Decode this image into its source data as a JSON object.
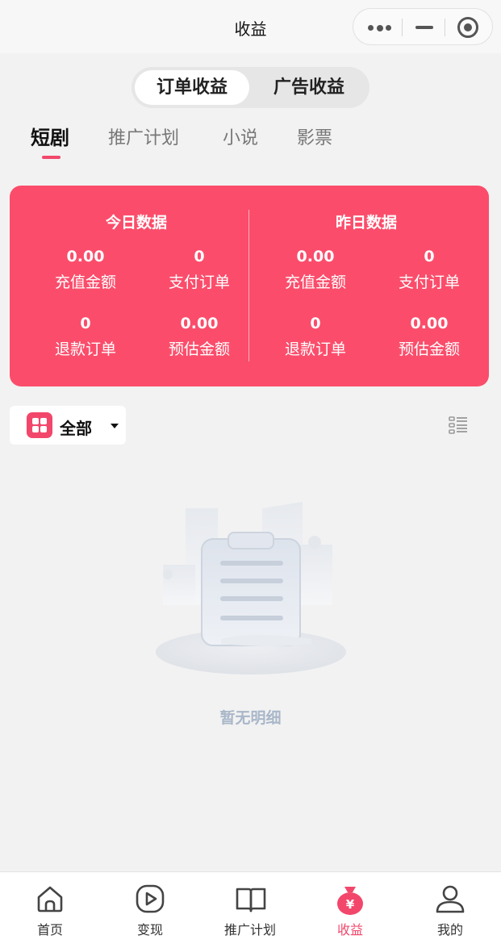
{
  "window": {
    "title": "收益",
    "capsule_icons": [
      "more-dots-icon",
      "minimize-icon",
      "close-target-icon"
    ]
  },
  "segment": {
    "options": [
      "订单收益",
      "广告收益"
    ],
    "selected": "订单收益"
  },
  "tabs": {
    "items": [
      "短剧",
      "推广计划",
      "小说",
      "影票"
    ],
    "active": "短剧"
  },
  "stats": {
    "bg_color": "#fb4d6b",
    "today": {
      "title": "今日数据",
      "recharge_amount": {
        "value": "0.00",
        "label": "充值金额"
      },
      "paid_orders": {
        "value": "0",
        "label": "支付订单"
      },
      "refund_orders": {
        "value": "0",
        "label": "退款订单"
      },
      "estimated_amount": {
        "value": "0.00",
        "label": "预估金额"
      }
    },
    "yesterday": {
      "title": "昨日数据",
      "recharge_amount": {
        "value": "0.00",
        "label": "充值金额"
      },
      "paid_orders": {
        "value": "0",
        "label": "支付订单"
      },
      "refund_orders": {
        "value": "0",
        "label": "退款订单"
      },
      "estimated_amount": {
        "value": "0.00",
        "label": "预估金额"
      }
    }
  },
  "filter": {
    "label": "全部",
    "icon": "grid-apps-icon",
    "view_toggle_icon": "list-view-icon"
  },
  "empty_state": {
    "text": "暂无明细",
    "icon": "empty-clipboard-illustration"
  },
  "bottom_nav": {
    "accent": "#f2476b",
    "items": [
      {
        "label": "首页",
        "icon": "home-icon"
      },
      {
        "label": "变现",
        "icon": "play-circle-icon"
      },
      {
        "label": "推广计划",
        "icon": "book-icon"
      },
      {
        "label": "收益",
        "icon": "money-bag-icon",
        "active": true
      },
      {
        "label": "我的",
        "icon": "user-icon"
      }
    ]
  }
}
